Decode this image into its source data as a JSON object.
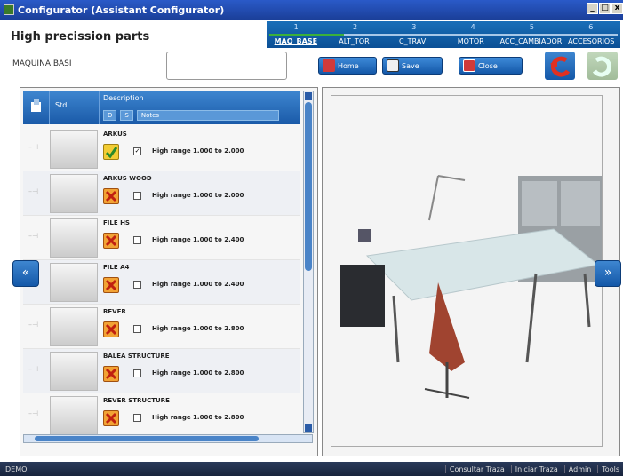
{
  "window": {
    "title": "Configurator (Assistant Configurator)",
    "buttons": [
      "_",
      "□",
      "x"
    ]
  },
  "app": {
    "title": "High precission parts"
  },
  "steps": [
    {
      "num": "1",
      "name": "MAQ_BASE",
      "active": true
    },
    {
      "num": "2",
      "name": "ALT_TOR",
      "active": false
    },
    {
      "num": "3",
      "name": "C_TRAV",
      "active": false
    },
    {
      "num": "4",
      "name": "MOTOR",
      "active": false
    },
    {
      "num": "5",
      "name": "ACC_CAMBIADOR",
      "active": false
    },
    {
      "num": "6",
      "name": "ACCESORIOS",
      "active": false
    }
  ],
  "field": {
    "label": "MAQUINA BASI",
    "value": ""
  },
  "toolbar": {
    "home": "Home",
    "save": "Save",
    "close": "Close"
  },
  "grid": {
    "col_std": "Std",
    "col_description": "Description",
    "sub_d": "D",
    "sub_s": "S",
    "sub_notes": "Notes",
    "rows": [
      {
        "name": "ARKUS",
        "status": "ok",
        "checked": true,
        "note": "High range 1.000 to 2.000"
      },
      {
        "name": "ARKUS WOOD",
        "status": "no",
        "checked": false,
        "note": "High range 1.000 to 2.000"
      },
      {
        "name": "FILE HS",
        "status": "no",
        "checked": false,
        "note": "High range 1.000 to 2.400"
      },
      {
        "name": "FILE A4",
        "status": "no",
        "checked": false,
        "note": "High range 1.000 to 2.400"
      },
      {
        "name": "REVER",
        "status": "no",
        "checked": false,
        "note": "High range 1.000 to 2.800"
      },
      {
        "name": "BALEA STRUCTURE",
        "status": "no",
        "checked": false,
        "note": "High range 1.000 to 2.800"
      },
      {
        "name": "REVER STRUCTURE",
        "status": "no",
        "checked": false,
        "note": "High range 1.000 to 2.800"
      }
    ]
  },
  "nav": {
    "prev": "«",
    "next": "»"
  },
  "taskbar": {
    "left": "DEMO",
    "items": [
      "Consultar Traza",
      "Iniciar Traza",
      "Admin",
      "Tools"
    ]
  },
  "colors": {
    "title_bar": "#1b3f99",
    "accent": "#1a6fb8",
    "progress": "#3bb03b"
  }
}
